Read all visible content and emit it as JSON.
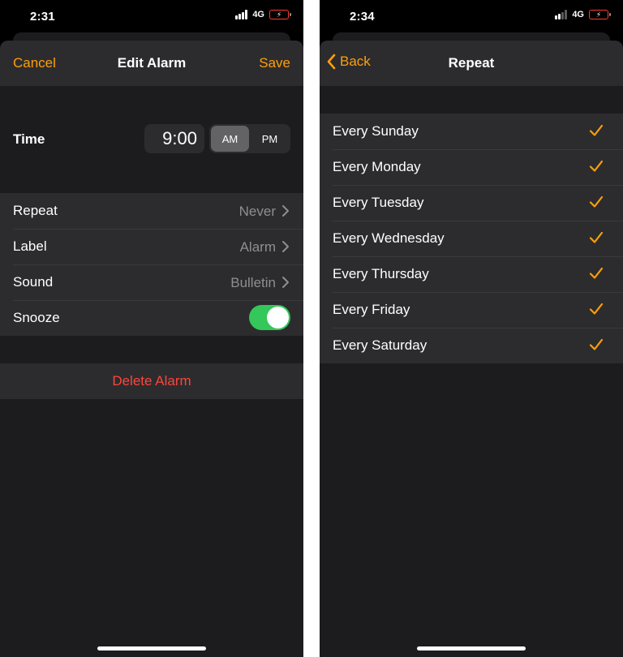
{
  "left": {
    "status": {
      "time": "2:31",
      "network": "4G"
    },
    "nav": {
      "cancel": "Cancel",
      "title": "Edit Alarm",
      "save": "Save"
    },
    "time_picker": {
      "label": "Time",
      "value": "9:00",
      "am": "AM",
      "pm": "PM",
      "selected": "AM"
    },
    "rows": [
      {
        "label": "Repeat",
        "value": "Never"
      },
      {
        "label": "Label",
        "value": "Alarm"
      },
      {
        "label": "Sound",
        "value": "Bulletin"
      }
    ],
    "snooze": {
      "label": "Snooze",
      "on": true
    },
    "delete_label": "Delete Alarm"
  },
  "right": {
    "status": {
      "time": "2:34",
      "network": "4G"
    },
    "nav": {
      "back": "Back",
      "title": "Repeat"
    },
    "days": [
      {
        "label": "Every Sunday",
        "checked": true
      },
      {
        "label": "Every Monday",
        "checked": true
      },
      {
        "label": "Every Tuesday",
        "checked": true
      },
      {
        "label": "Every Wednesday",
        "checked": true
      },
      {
        "label": "Every Thursday",
        "checked": true
      },
      {
        "label": "Every Friday",
        "checked": true
      },
      {
        "label": "Every Saturday",
        "checked": true
      }
    ]
  },
  "colors": {
    "accent": "#ff9f0a",
    "toggle_on": "#34c759",
    "destructive": "#ff453a",
    "cell_bg": "#2c2c2e",
    "sheet_bg": "#1c1c1e"
  }
}
